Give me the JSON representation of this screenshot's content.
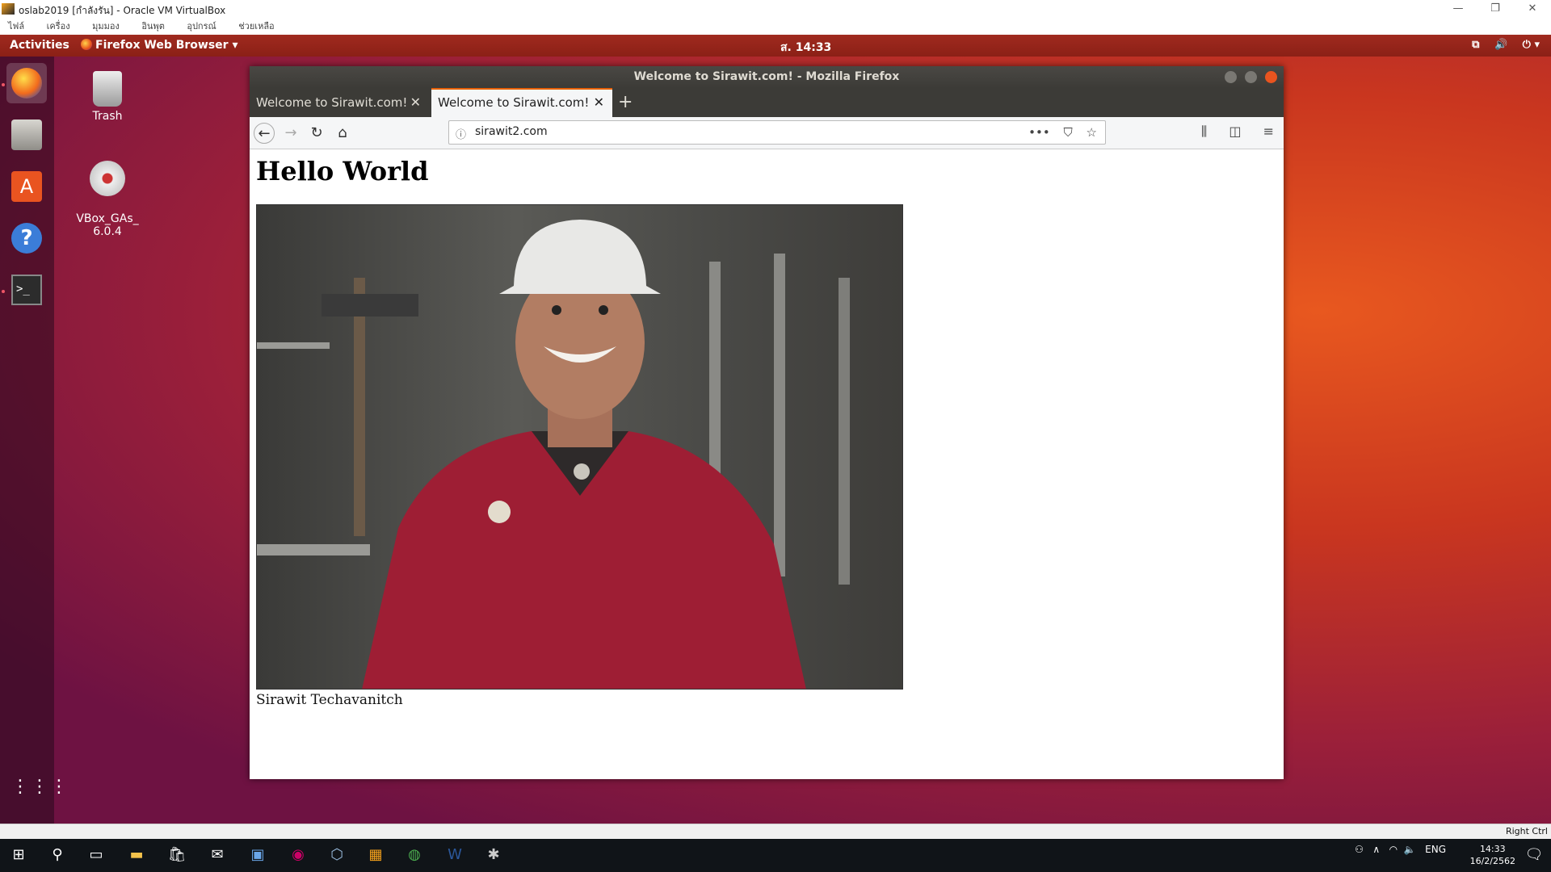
{
  "vbox": {
    "window_title": "oslab2019 [กำลังรัน] - Oracle VM VirtualBox",
    "menu": [
      "ไฟล์",
      "เครื่อง",
      "มุมมอง",
      "อินพุต",
      "อุปกรณ์",
      "ช่วยเหลือ"
    ],
    "status_host_key": "Right Ctrl"
  },
  "ubuntu": {
    "activities_label": "Activities",
    "app_menu_label": "Firefox Web Browser ▾",
    "clock": "ส. 14:33",
    "desktop_icons": [
      {
        "label": "Trash"
      },
      {
        "label": "VBox_GAs_\n6.0.4"
      }
    ]
  },
  "firefox": {
    "window_title": "Welcome to Sirawit.com! - Mozilla Firefox",
    "tabs": [
      {
        "label": "Welcome to Sirawit.com!",
        "active": false
      },
      {
        "label": "Welcome to Sirawit.com!",
        "active": true
      }
    ],
    "url": "sirawit2.com"
  },
  "page": {
    "heading": "Hello World",
    "caption": "Sirawit Techavanitch"
  },
  "windows": {
    "lang": "ENG",
    "time": "14:33",
    "date": "16/2/2562"
  },
  "colors": {
    "ubuntu_topbar": "#8b2016",
    "tab_accent": "#e66000",
    "taskbar": "#101418"
  }
}
